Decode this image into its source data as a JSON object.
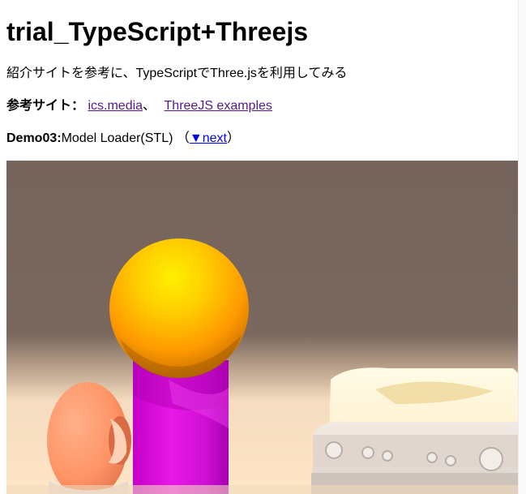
{
  "page": {
    "title": "trial_TypeScript+Threejs",
    "description": "紹介サイトを参考に、TypeScriptでThree.jsを利用してみる",
    "reference": {
      "label": "参考サイト：",
      "links": [
        {
          "text": "ics.media"
        },
        {
          "text": "ThreeJS examples"
        }
      ],
      "separator": "、"
    },
    "demo": {
      "label": "Demo03:",
      "text": "Model Loader(STL) （",
      "next_link": "▼next",
      "close": "）"
    }
  },
  "scene": {
    "background_color": "#75645c",
    "floor_color": "#ffe2be",
    "objects": [
      "sphere",
      "pillar",
      "torus",
      "tv-box"
    ],
    "colors": {
      "sphere": "#ffb000",
      "pillar": "#e010e0",
      "torus": "#ff9a6e",
      "box": "#fff6dc"
    }
  }
}
